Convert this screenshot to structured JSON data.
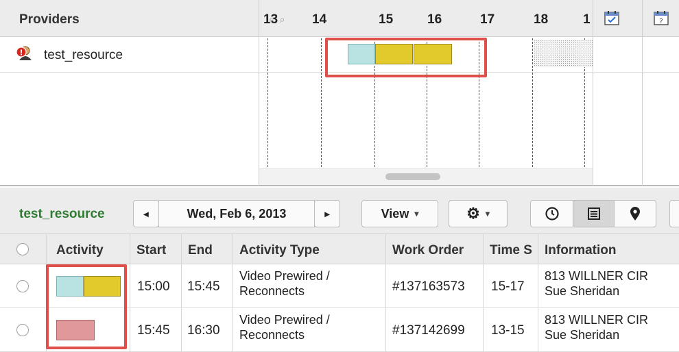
{
  "header": {
    "providers_label": "Providers",
    "hours": [
      "13",
      "14",
      "15",
      "16",
      "17",
      "18",
      "1"
    ],
    "zoom_icons": "⌕ ⌕",
    "calendar_icons": [
      "calendar-check-icon",
      "calendar-question-icon"
    ]
  },
  "provider": {
    "name": "test_resource",
    "icon": "alert-person-icon"
  },
  "gantt_bars": [
    {
      "name": "activity-segment-1",
      "color": "#b9e2e3"
    },
    {
      "name": "activity-segment-2",
      "color": "#e2c92c"
    },
    {
      "name": "activity-segment-3",
      "color": "#e2c92c"
    }
  ],
  "toolbar": {
    "resource_name": "test_resource",
    "prev_icon": "◂",
    "date": "Wed, Feb 6, 2013",
    "next_icon": "▸",
    "view_label": "View",
    "caret": "▾",
    "settings_icon": "⚙",
    "clock_icon": "⧗",
    "list_icon": "☰",
    "map_icon": "◉"
  },
  "table": {
    "columns": [
      "Activity",
      "Start",
      "End",
      "Activity Type",
      "Work Order",
      "Time S",
      "Information"
    ],
    "rows": [
      {
        "start": "15:00",
        "end": "15:45",
        "activity_type_line1": "Video Prewired /",
        "activity_type_line2": "Reconnects",
        "work_order": "#137163573",
        "time_slot": "15-17",
        "info_line1": "813 WILLNER CIR",
        "info_line2": "Sue Sheridan",
        "activity_colors": [
          "#b9e2e3",
          "#e2c92c"
        ]
      },
      {
        "start": "15:45",
        "end": "16:30",
        "activity_type_line1": "Video Prewired /",
        "activity_type_line2": "Reconnects",
        "work_order": "#137142699",
        "time_slot": "13-15",
        "info_line1": "813 WILLNER CIR",
        "info_line2": "Sue Sheridan",
        "activity_colors": [
          "#e0989a"
        ]
      }
    ]
  },
  "colors": {
    "highlight": "#e0504a",
    "resource_green": "#2e7d32"
  }
}
